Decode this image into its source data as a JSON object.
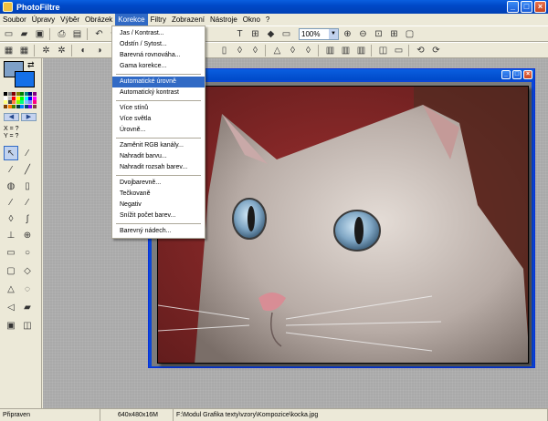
{
  "app": {
    "title": "PhotoFiltre"
  },
  "menubar": [
    {
      "label": "Soubor"
    },
    {
      "label": "Úpravy"
    },
    {
      "label": "Výběr"
    },
    {
      "label": "Obrázek"
    },
    {
      "label": "Korekce"
    },
    {
      "label": "Filtry"
    },
    {
      "label": "Zobrazení"
    },
    {
      "label": "Nástroje"
    },
    {
      "label": "Okno"
    },
    {
      "label": "?"
    }
  ],
  "toolbar": {
    "zoom_value": "100%"
  },
  "dropdown": {
    "items": [
      "Jas / Kontrast...",
      "Odstín / Sytost...",
      "Barevná rovnováha...",
      "Gama korekce...",
      "Automatické úrovně",
      "Automatický kontrast",
      "Více stínů",
      "Více světla",
      "Úrovně...",
      "Zaměnit RGB kanály...",
      "Nahradit barvu...",
      "Nahradit rozsah barev...",
      "Dvojbarevně...",
      "Tečkovaně",
      "Negativ",
      "Snížit počet barev...",
      "Barevný nádech..."
    ],
    "highlighted": "Automatické úrovně"
  },
  "panel": {
    "coord_x": "X = ?",
    "coord_y": "Y = ?"
  },
  "statusbar": {
    "status": "Připraven",
    "dimensions": "640x480x16M",
    "path": "F:\\Modul Grafika texty\\vzory\\Kompozice\\kocka.jpg"
  },
  "colors": {
    "accent": "#316ac5",
    "titlebar": "#0049c8"
  }
}
